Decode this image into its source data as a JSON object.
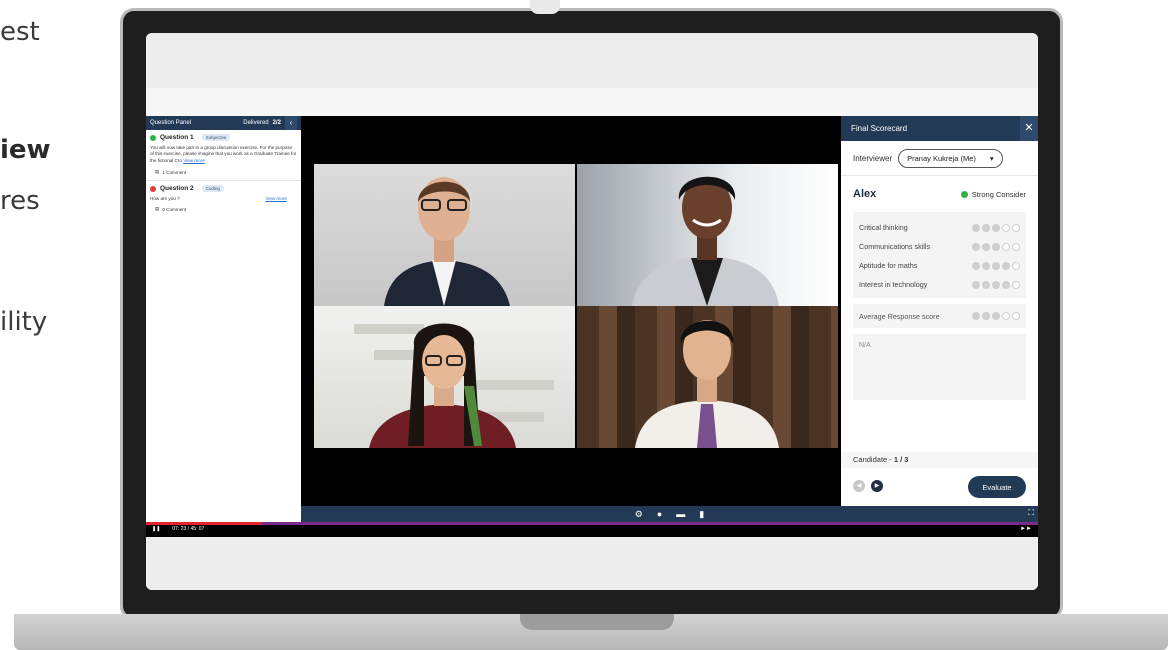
{
  "marketing_text": {
    "line1": "est",
    "line2": "iew",
    "line3": "res",
    "line4": "ility"
  },
  "question_panel": {
    "title": "Question Panel",
    "delivered_label": "Delivered",
    "delivered_count": "2/2",
    "collapse_icon": "chevron-left-icon",
    "questions": [
      {
        "title": "Question 1",
        "tag": "Subjective",
        "status_color": "#2bb14a",
        "body": "You will now take part in a group discussion exercise. For the purpose of this exercise, please imagine that you work as a Graduate Trainee for the fictional Cro",
        "view_more": "View more",
        "comments": "1 Comment"
      },
      {
        "title": "Question 2",
        "tag": "Coding",
        "status_color": "#e23b3b",
        "body": "How are you ?",
        "view_more": "View more",
        "comments": "0 Comment"
      }
    ]
  },
  "scorecard": {
    "title": "Final Scorecard",
    "close_icon": "close-icon",
    "interviewer_label": "Interviewer",
    "interviewer_value": "Pranay Kukreja (Me)",
    "candidate_name": "Alex",
    "status_text": "Strong Consider",
    "status_color": "#2bb14a",
    "skills": [
      {
        "name": "Critical thinking",
        "score": 3,
        "max": 5
      },
      {
        "name": "Communications skills",
        "score": 3,
        "max": 5
      },
      {
        "name": "Aptitude for maths",
        "score": 4,
        "max": 5
      },
      {
        "name": "Interest in technology",
        "score": 4,
        "max": 5
      }
    ],
    "average_label": "Average Response score",
    "average_score": 3,
    "average_max": 5,
    "notes": "N/A",
    "candidate_label": "Candidate -",
    "candidate_count": "1 / 3",
    "evaluate_label": "Evaluate"
  },
  "player": {
    "time": "07: 23 / 45: 07",
    "progress": 0.13,
    "controls": [
      "settings-icon",
      "chat-icon",
      "messages-icon",
      "notes-icon"
    ]
  },
  "colors": {
    "header_navy": "#233a56",
    "timeline_purple": "#7a2b8c",
    "progress_red": "#e4242b"
  }
}
